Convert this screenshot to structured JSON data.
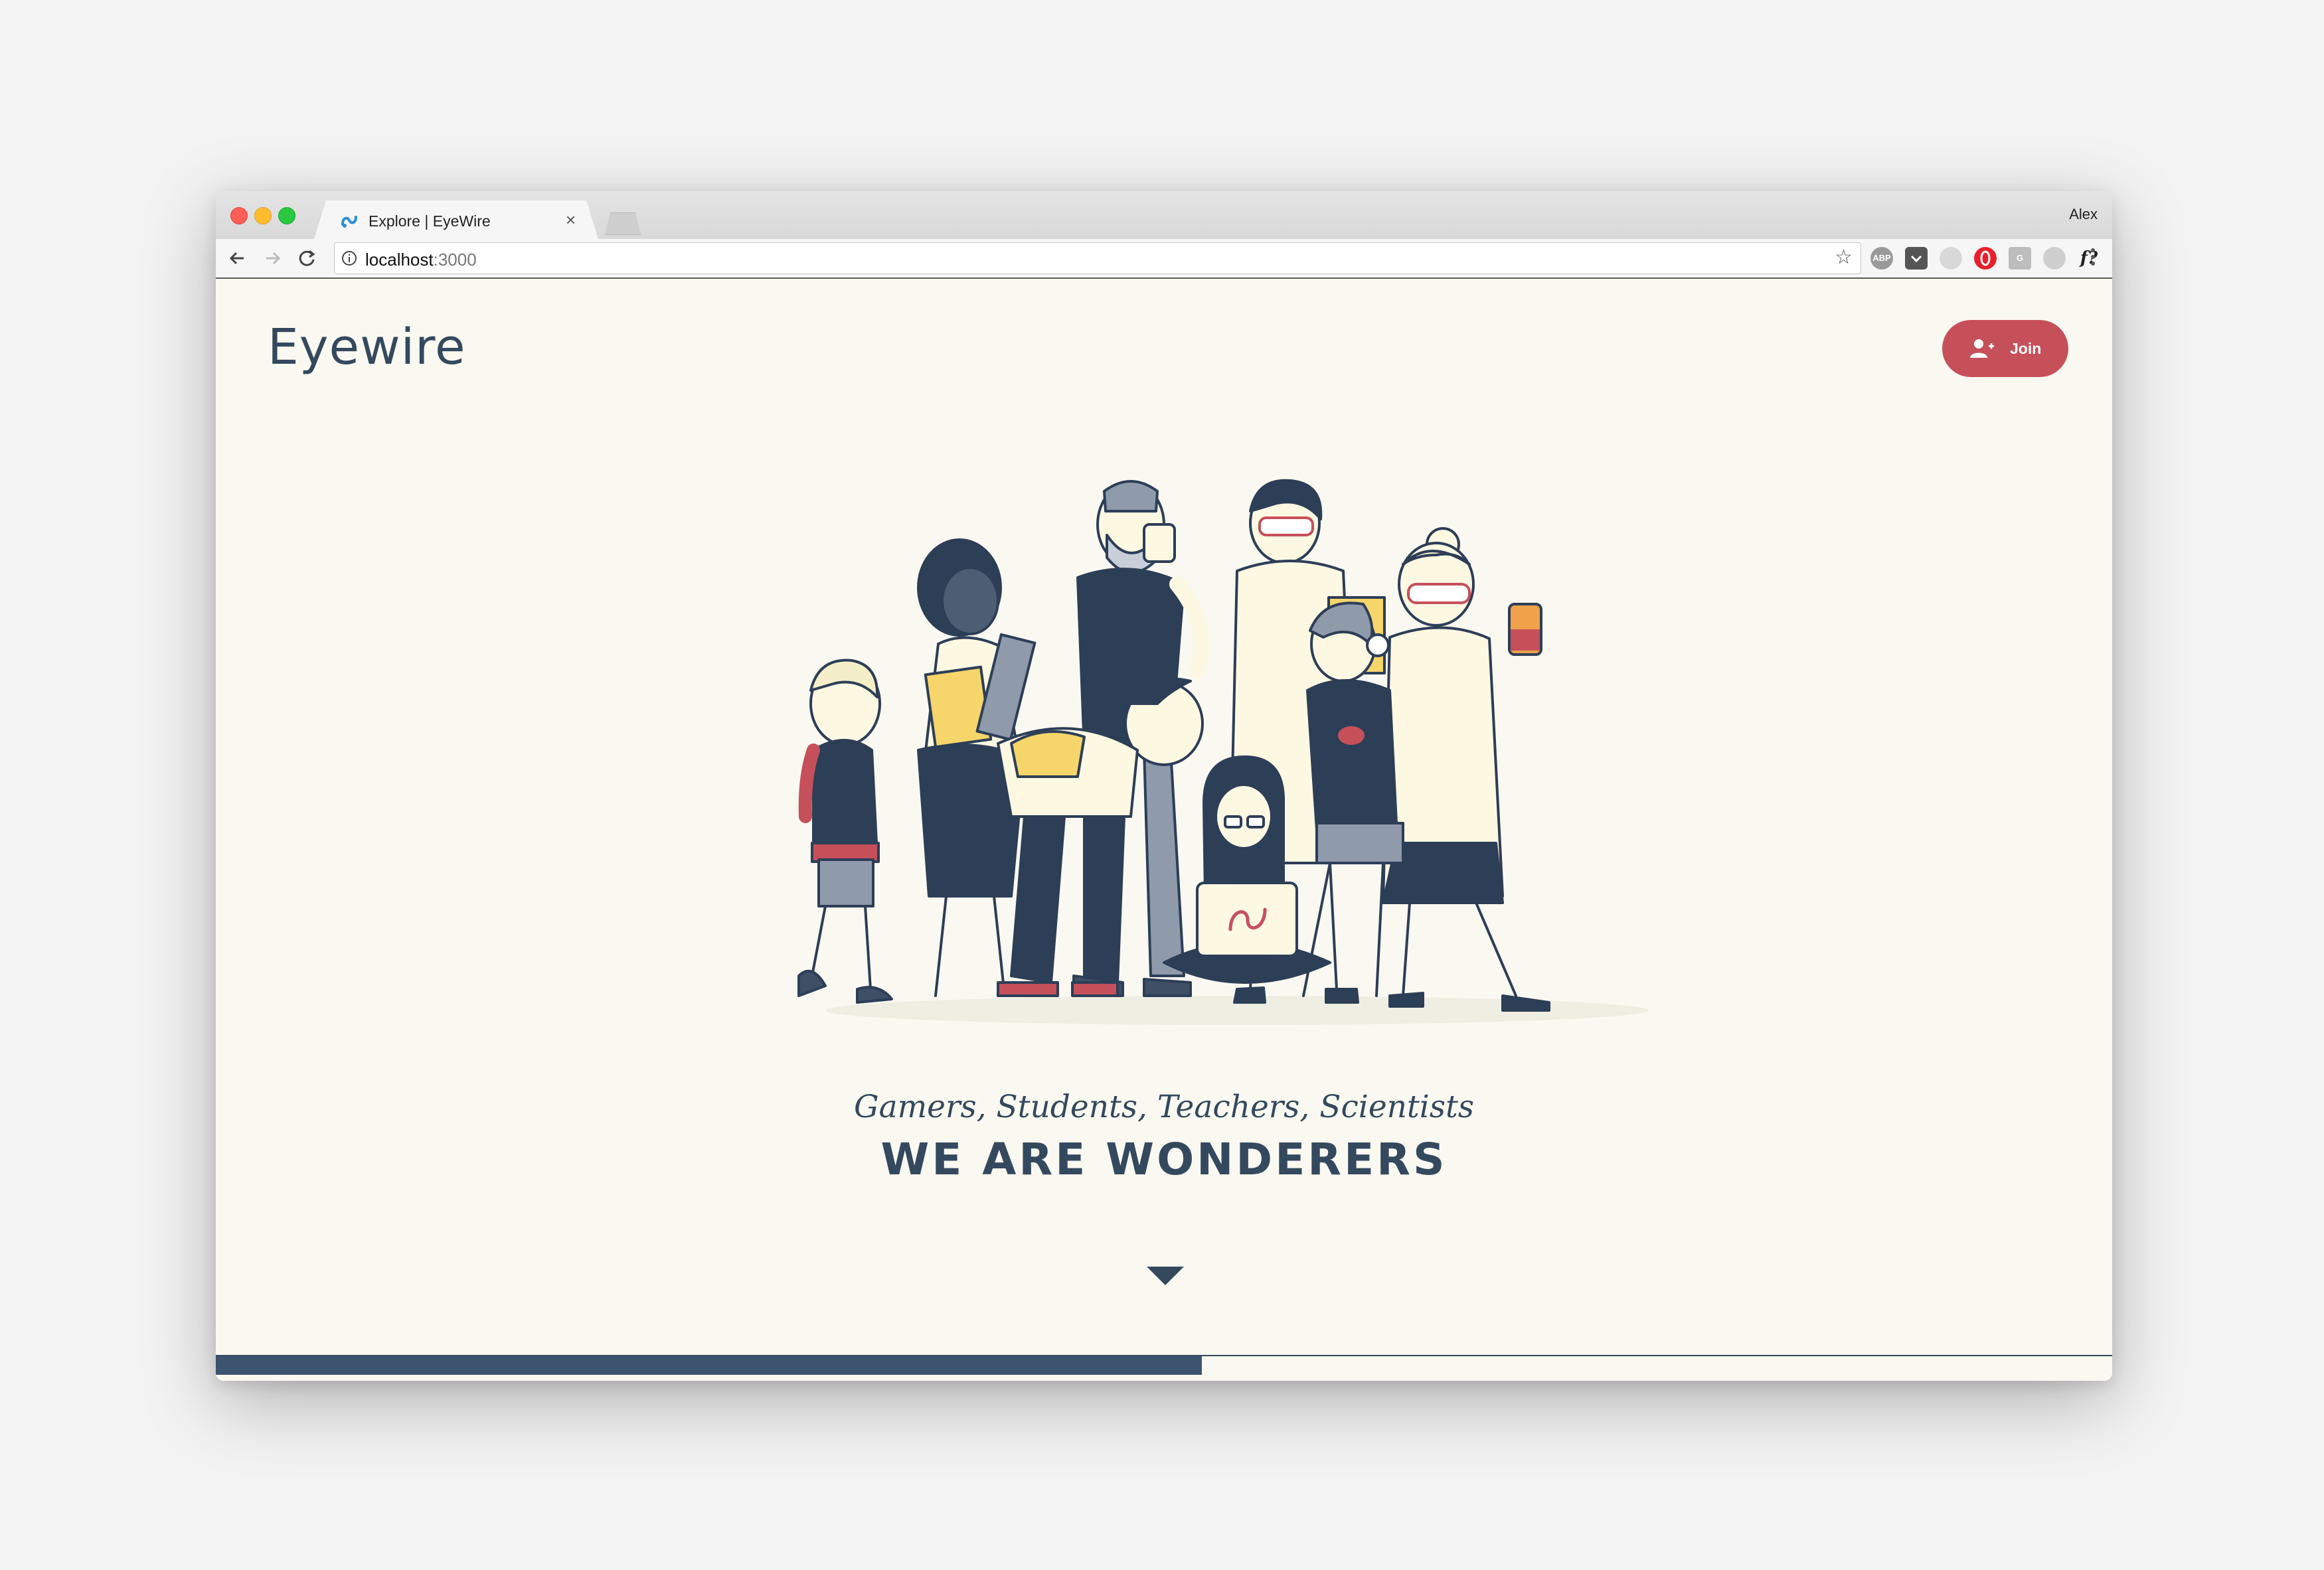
{
  "browser": {
    "tab_title": "Explore | EyeWire",
    "tab_close": "×",
    "profile_name": "Alex",
    "url_host": "localhost",
    "url_port": ":3000",
    "extensions": [
      "abp-icon",
      "pocket-icon",
      "drive-icon",
      "opera-icon",
      "google-icon",
      "cloud-icon",
      "whatfont-icon",
      "screenshot-icon",
      "pinterest-icon",
      "json-icon",
      "vue-icon",
      "chat-icon"
    ],
    "extension_labels": {
      "abp": "ABP",
      "google": "G",
      "whatfont": "f?",
      "json": "{≡}"
    }
  },
  "page": {
    "logo": "Eyewire",
    "join_label": "Join",
    "tagline": "Gamers, Students, Teachers, Scientists",
    "headline": "WE ARE WONDERERS",
    "scroll_progress": 0.52
  },
  "colors": {
    "brand_navy": "#34495e",
    "join_red": "#c6505a",
    "page_background": "#faf9f1",
    "progress_fill": "#3c5470"
  }
}
